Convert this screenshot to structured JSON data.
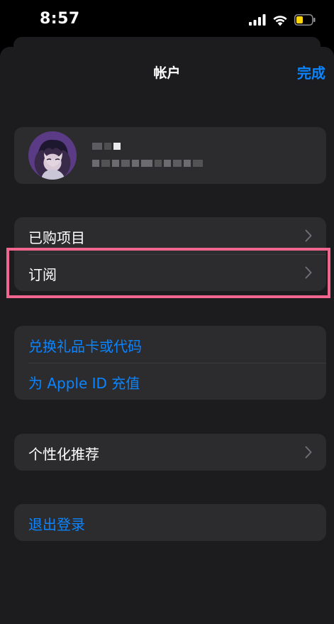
{
  "status_bar": {
    "time": "8:57",
    "icons": [
      "cellular-signal-icon",
      "wifi-icon",
      "battery-icon"
    ],
    "battery_color": "#ffd60a"
  },
  "nav": {
    "title": "帐户",
    "done_label": "完成"
  },
  "profile": {
    "avatar": "avatar",
    "name_redacted": true,
    "email_redacted": true
  },
  "group1": {
    "items": [
      {
        "label": "已购项目",
        "chevron": true
      },
      {
        "label": "订阅",
        "chevron": true
      }
    ]
  },
  "group2": {
    "items": [
      {
        "label": "兑换礼品卡或代码"
      },
      {
        "label": "为 Apple ID 充值"
      }
    ]
  },
  "group3": {
    "items": [
      {
        "label": "个性化推荐",
        "chevron": true
      }
    ]
  },
  "group4": {
    "items": [
      {
        "label": "退出登录"
      }
    ]
  },
  "colors": {
    "accent": "#0a84ff",
    "highlight": "#f0668e",
    "background": "#1c1c1e",
    "cell": "#2c2c2e"
  }
}
